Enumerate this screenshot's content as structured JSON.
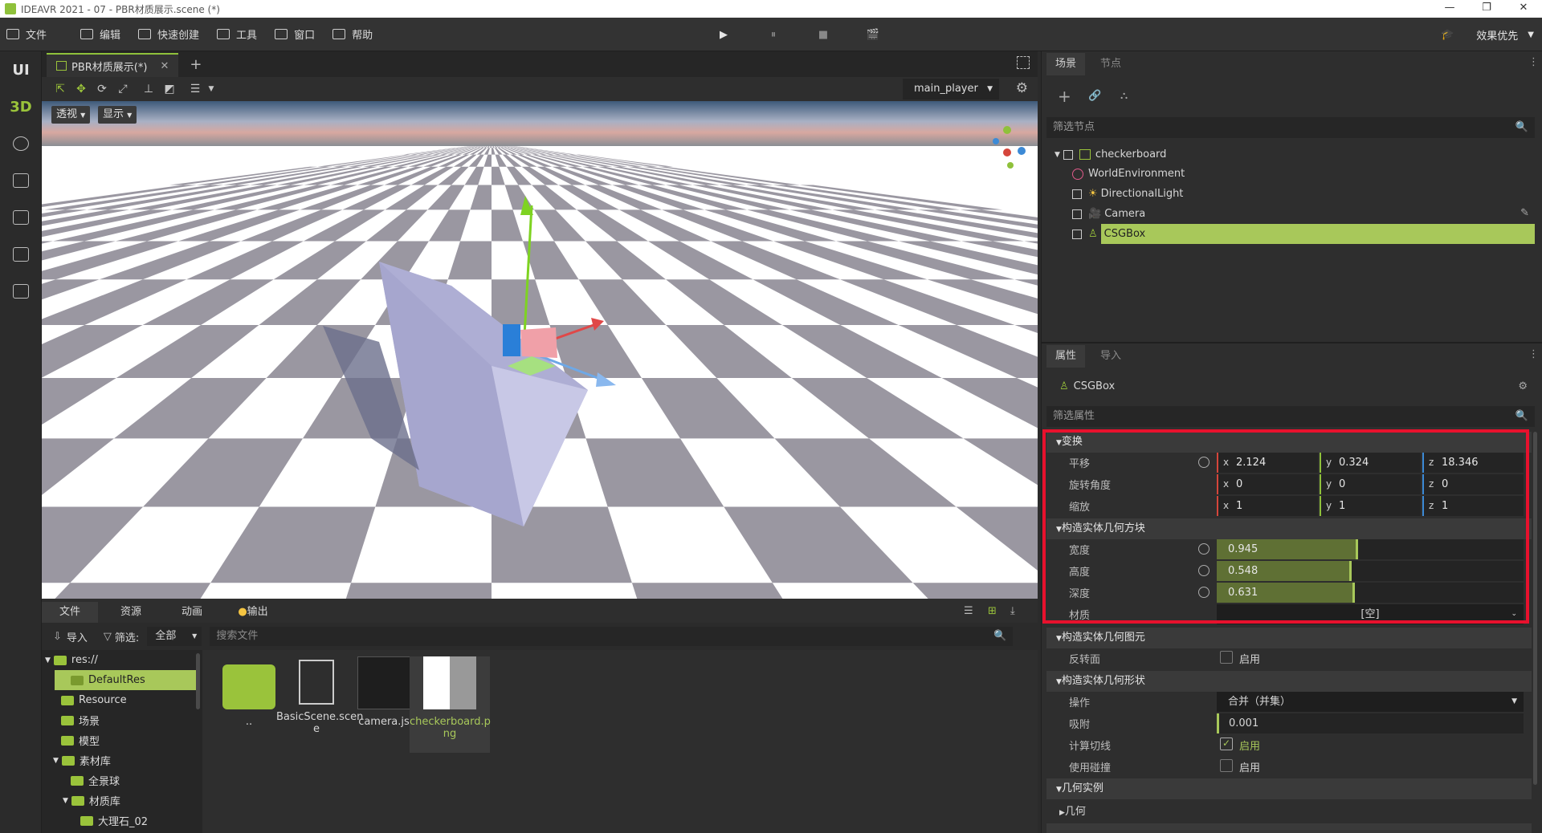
{
  "window": {
    "title": "IDEAVR 2021 - 07 - PBR材质展示.scene (*)",
    "min": "—",
    "restore": "❐",
    "close": "✕"
  },
  "menu": {
    "items": [
      {
        "label": "文件",
        "icon": "folder-icon"
      },
      {
        "label": "编辑",
        "icon": "crop-icon"
      },
      {
        "label": "快速创建",
        "icon": "edit-icon"
      },
      {
        "label": "工具",
        "icon": "toolbox-icon"
      },
      {
        "label": "窗口",
        "icon": "window-icon"
      },
      {
        "label": "帮助",
        "icon": "help-icon"
      }
    ],
    "play": "▶",
    "pause": "⏸",
    "stop": "■",
    "movie": "🎬",
    "perf_label": "效果优先"
  },
  "left_modes": {
    "ui": "UI",
    "three_d": "3D"
  },
  "scene_tab": {
    "label": "PBR材质展示(*)",
    "close": "✕",
    "add": "+"
  },
  "viewport": {
    "camera": "main_player",
    "view_btn": "透视",
    "display_btn": "显示"
  },
  "bottom": {
    "tabs": [
      "文件",
      "资源",
      "动画",
      "输出"
    ],
    "import_label": "导入",
    "filter_label": "筛选:",
    "filter_value": "全部",
    "search_placeholder": "搜索文件",
    "tree": [
      "res://",
      "DefaultRes",
      "Resource",
      "场景",
      "模型",
      "素材库",
      "全景球",
      "材质库",
      "大理石_02"
    ],
    "files": [
      {
        "name": ".."
      },
      {
        "name": "BasicScene.scen e"
      },
      {
        "name": "camera.js"
      },
      {
        "name": "checkerboard.p ng"
      }
    ]
  },
  "scene_panel": {
    "tabs": [
      "场景",
      "节点"
    ],
    "filter_placeholder": "筛选节点",
    "nodes": [
      "checkerboard",
      "WorldEnvironment",
      "DirectionalLight",
      "Camera",
      "CSGBox"
    ]
  },
  "inspector": {
    "tabs": [
      "属性",
      "导入"
    ],
    "object": "CSGBox",
    "filter_placeholder": "筛选属性",
    "transform": {
      "title": "变换",
      "translate_label": "平移",
      "translate": {
        "x": "2.124",
        "y": "0.324",
        "z": "18.346"
      },
      "rotate_label": "旋转角度",
      "rotate": {
        "x": "0",
        "y": "0",
        "z": "0"
      },
      "scale_label": "缩放",
      "scale": {
        "x": "1",
        "y": "1",
        "z": "1"
      }
    },
    "box": {
      "title": "构造实体几何方块",
      "width_label": "宽度",
      "width": "0.945",
      "height_label": "高度",
      "height": "0.548",
      "depth_label": "深度",
      "depth": "0.631",
      "material_label": "材质",
      "material": "[空]",
      "fill_percent": {
        "width": 46,
        "height": 44,
        "depth": 45
      }
    },
    "primitive": {
      "title": "构造实体几何图元",
      "flip_label": "反转面",
      "flip_value": "启用",
      "flip_checked": false
    },
    "shape": {
      "title": "构造实体几何形状",
      "op_label": "操作",
      "op_value": "合并（并集）",
      "snap_label": "吸附",
      "snap_value": "0.001",
      "tangent_label": "计算切线",
      "tangent_value": "启用",
      "tangent_checked": true,
      "collision_label": "使用碰撞",
      "collision_value": "启用",
      "collision_checked": false
    },
    "geometry_instance": {
      "title": "几何实例",
      "geometry": "几何"
    },
    "axis_labels": {
      "x": "x",
      "y": "y",
      "z": "z"
    }
  },
  "colors": {
    "accent": "#8fc13b",
    "highlight": "#e8112d",
    "x_axis": "#d5453b",
    "y_axis": "#8fc13b",
    "z_axis": "#3c8ad6"
  }
}
